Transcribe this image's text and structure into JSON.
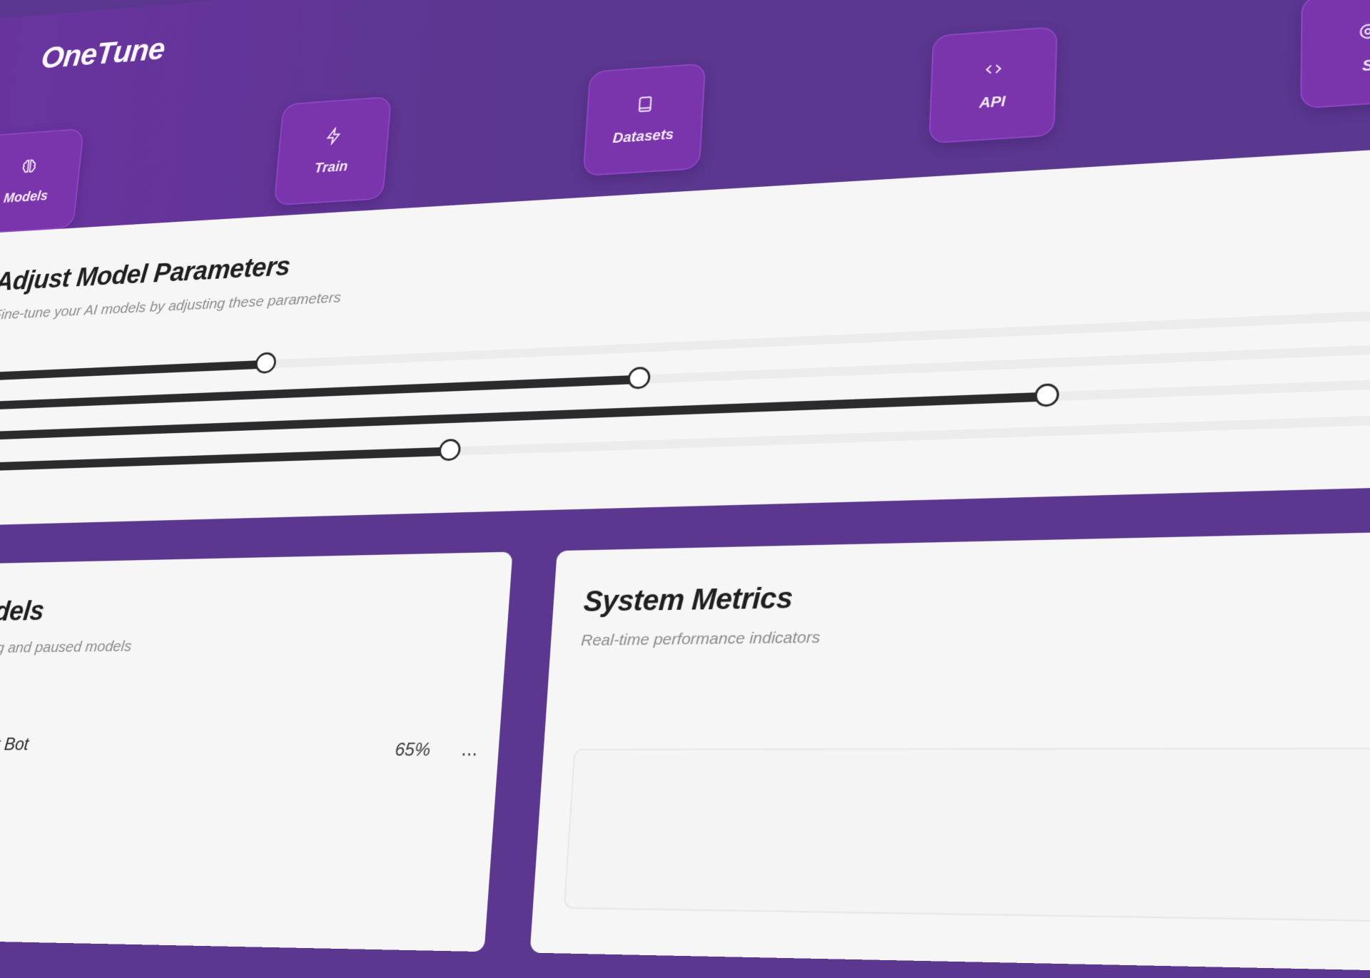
{
  "app": {
    "title": "OneTune"
  },
  "nav": {
    "items": [
      {
        "label": "Models",
        "icon": "brain-icon"
      },
      {
        "label": "Train",
        "icon": "zap-icon"
      },
      {
        "label": "Datasets",
        "icon": "book-icon"
      },
      {
        "label": "API",
        "icon": "code-icon"
      },
      {
        "label": "S",
        "icon": "settings-icon"
      }
    ]
  },
  "parameters": {
    "title": "Adjust Model Parameters",
    "subtitle": "Fine-tune your AI models by adjusting these parameters",
    "sliders": [
      {
        "value": 0.2
      },
      {
        "value": 0.45
      },
      {
        "value": 0.7
      },
      {
        "value": 0.33
      }
    ]
  },
  "models": {
    "title": "Models",
    "subtitle": "Training and paused models",
    "items": [
      {
        "name": "Support Bot",
        "progress": "65%"
      }
    ]
  },
  "metrics": {
    "title": "System Metrics",
    "subtitle": "Real-time performance indicators"
  },
  "colors": {
    "brand": "#5b378f",
    "tile": "#7a35ad",
    "slider_fill": "#2b2b2e"
  }
}
